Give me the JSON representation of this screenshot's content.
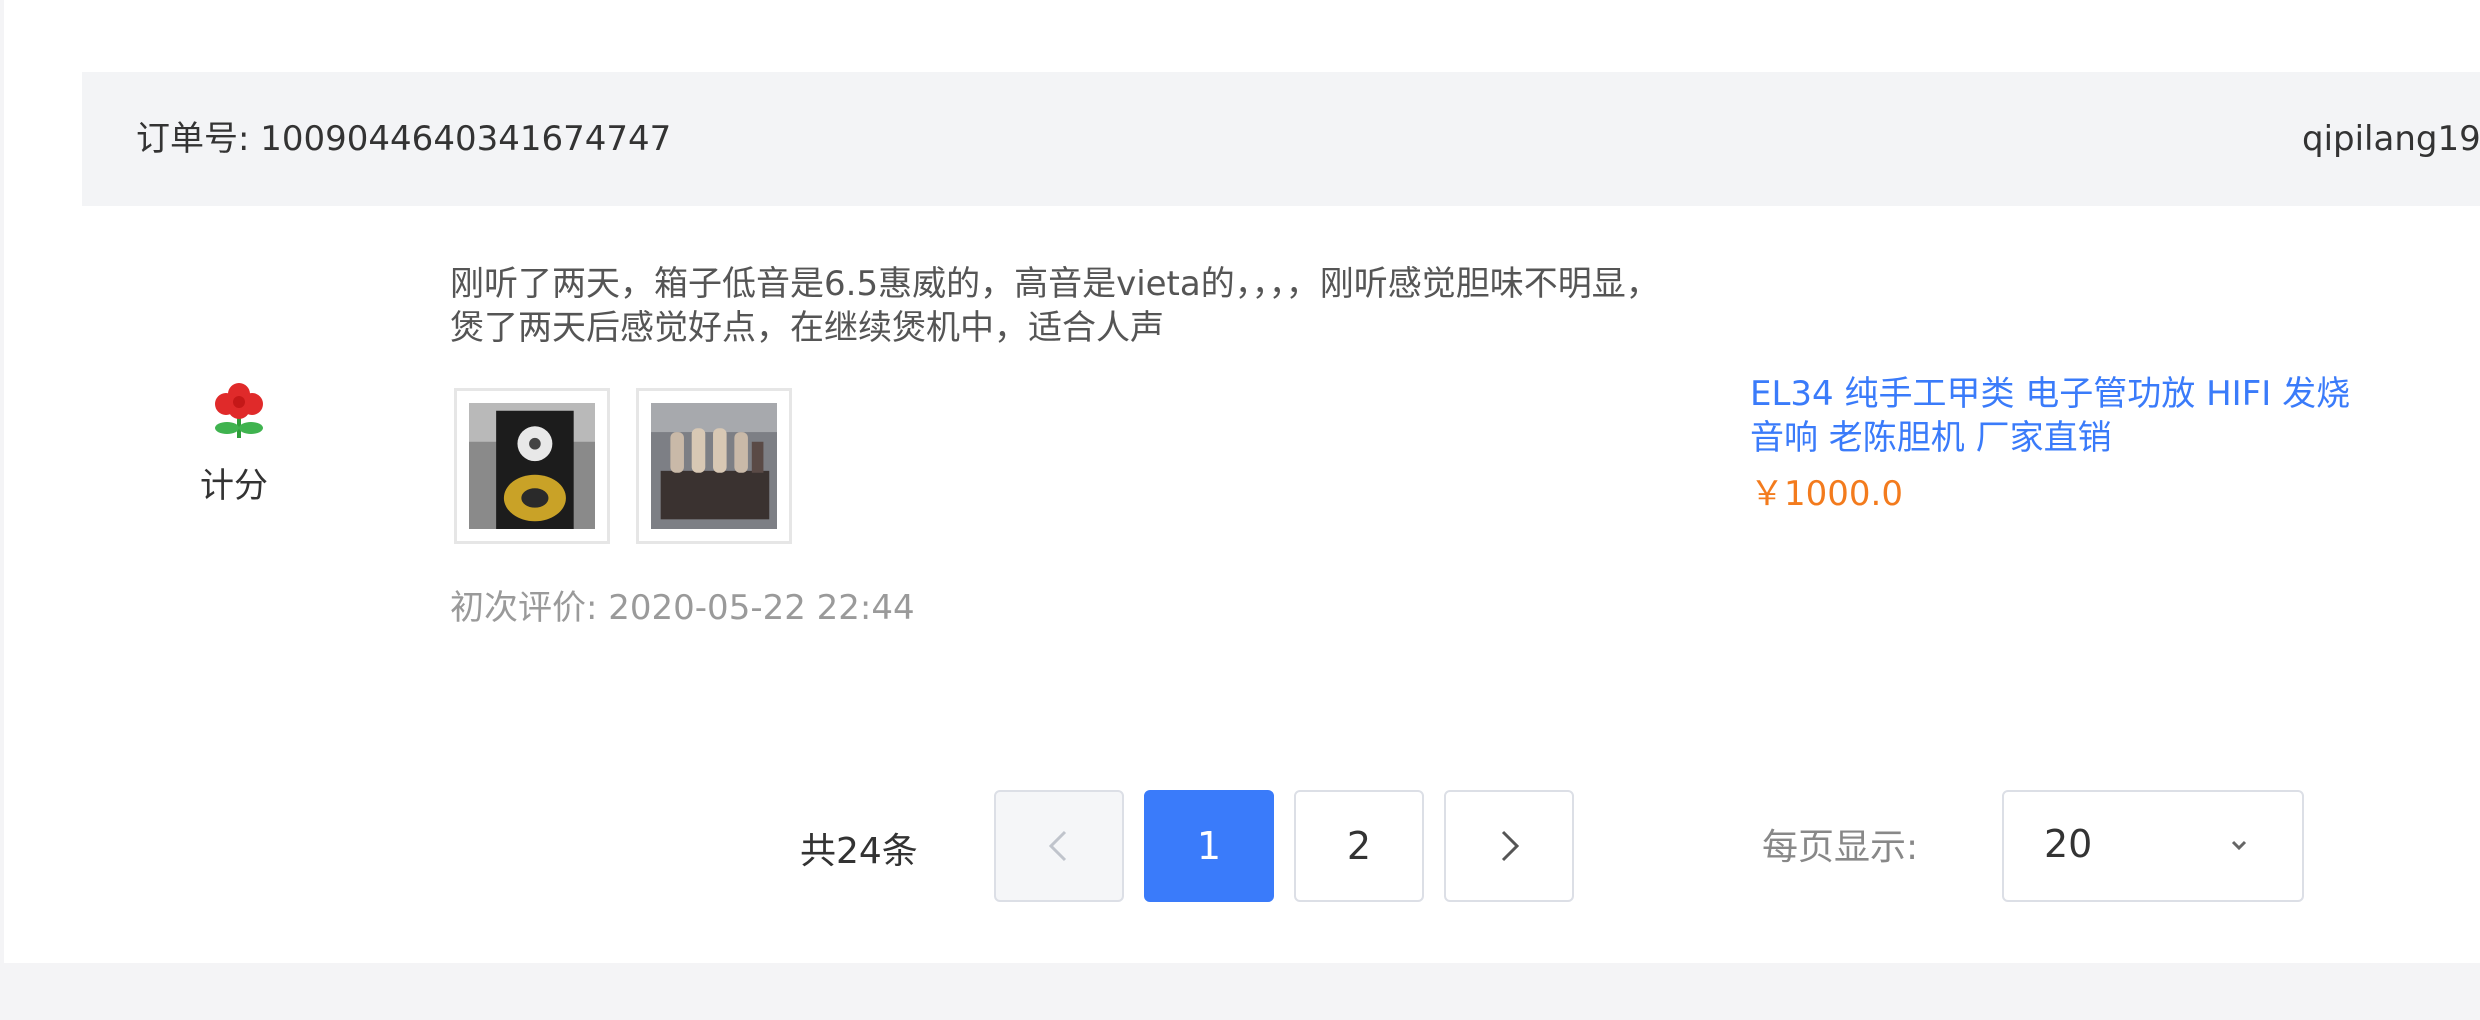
{
  "order": {
    "number_label": "订单号: 1009044640341674747",
    "user": "qipilang19"
  },
  "score": {
    "icon": "flower-icon",
    "label": "计分"
  },
  "review": {
    "text": "刚听了两天，箱子低音是6.5惠威的，高音是vieta的，，，，刚听感觉胆味不明显，煲了两天后感觉好点，在继续煲机中，适合人声",
    "date": "初次评价: 2020-05-22 22:44"
  },
  "product": {
    "name": "EL34 纯手工甲类 电子管功放 HIFI 发烧音响 老陈胆机 厂家直销",
    "price": "￥1000.0"
  },
  "pagination": {
    "total": "共24条",
    "pages": [
      "1",
      "2"
    ],
    "current_page": "1",
    "per_page_label": "每页显示:",
    "per_page_value": "20"
  },
  "colors": {
    "accent": "#3a7bfa",
    "price": "#f37b1d"
  }
}
